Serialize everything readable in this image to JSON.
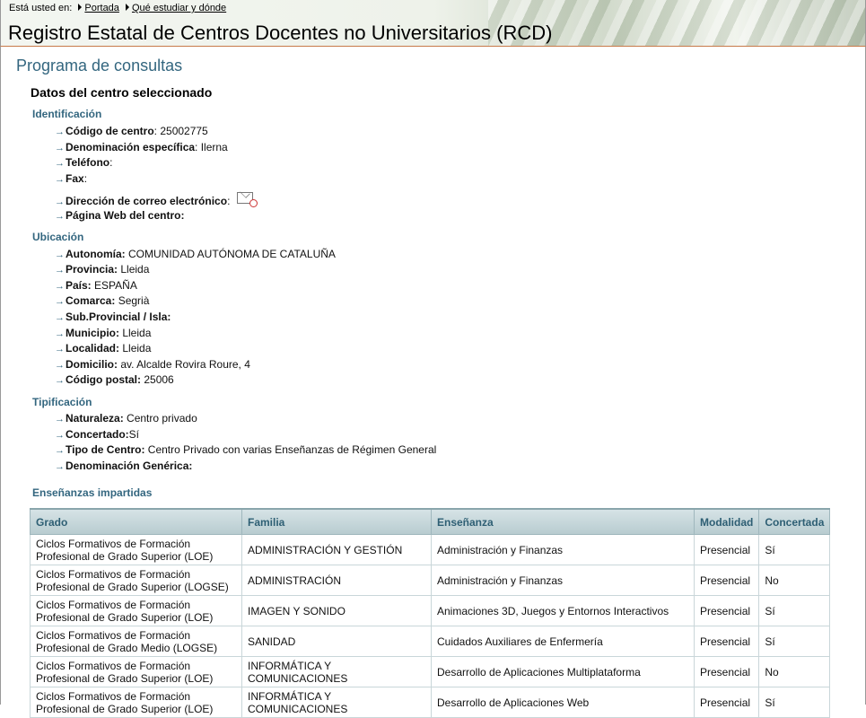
{
  "breadcrumb": {
    "prefix": "Está usted en:",
    "items": [
      "Portada",
      "Qué estudiar y dónde"
    ]
  },
  "site_title": "Registro Estatal de Centros Docentes no Universitarios (RCD)",
  "page_title": "Programa de consultas",
  "section_title": "Datos del centro seleccionado",
  "identificacion": {
    "heading": "Identificación",
    "codigo_label": "Código de centro",
    "codigo_value": ": 25002775",
    "denominacion_label": "Denominación específica",
    "denominacion_value": ": Ilerna",
    "telefono_label": "Teléfono",
    "telefono_value": ":",
    "fax_label": "Fax",
    "fax_value": ":",
    "correo_label": "Dirección de correo electrónico",
    "correo_value": ":",
    "web_label": "Página Web del centro:"
  },
  "ubicacion": {
    "heading": "Ubicación",
    "rows": [
      {
        "label": "Autonomía:",
        "value": "COMUNIDAD AUTÓNOMA DE CATALUÑA"
      },
      {
        "label": "Provincia:",
        "value": "Lleida"
      },
      {
        "label": "País:",
        "value": "ESPAÑA"
      },
      {
        "label": "Comarca:",
        "value": "Segrià"
      },
      {
        "label": "Sub.Provincial / Isla:",
        "value": ""
      },
      {
        "label": "Municipio:",
        "value": "Lleida"
      },
      {
        "label": "Localidad:",
        "value": "Lleida"
      },
      {
        "label": "Domicilio:",
        "value": "av. Alcalde Rovira Roure, 4"
      },
      {
        "label": "Código postal:",
        "value": "25006"
      }
    ]
  },
  "tipificacion": {
    "heading": "Tipificación",
    "rows": [
      {
        "label": "Naturaleza:",
        "value": "Centro privado"
      },
      {
        "label": "Concertado:",
        "value": "Sí"
      },
      {
        "label": "Tipo de Centro:",
        "value": "Centro Privado con varias Enseñanzas de Régimen General"
      },
      {
        "label": "Denominación Genérica:",
        "value": ""
      }
    ]
  },
  "ensenanzas": {
    "heading": "Enseñanzas impartidas",
    "columns": [
      "Grado",
      "Familia",
      "Enseñanza",
      "Modalidad",
      "Concertada"
    ],
    "rows": [
      [
        "Ciclos Formativos de Formación Profesional de Grado Superior (LOE)",
        "ADMINISTRACIÓN Y GESTIÓN",
        "Administración y Finanzas",
        "Presencial",
        "Sí"
      ],
      [
        "Ciclos Formativos de Formación Profesional de Grado Superior (LOGSE)",
        "ADMINISTRACIÓN",
        "Administración y Finanzas",
        "Presencial",
        "No"
      ],
      [
        "Ciclos Formativos de Formación Profesional de Grado Superior (LOE)",
        "IMAGEN Y SONIDO",
        "Animaciones 3D, Juegos y Entornos Interactivos",
        "Presencial",
        "Sí"
      ],
      [
        "Ciclos Formativos de Formación Profesional de Grado Medio (LOGSE)",
        "SANIDAD",
        "Cuidados Auxiliares de Enfermería",
        "Presencial",
        "Sí"
      ],
      [
        "Ciclos Formativos de Formación Profesional de Grado Superior (LOE)",
        "INFORMÁTICA Y COMUNICACIONES",
        "Desarrollo de Aplicaciones Multiplataforma",
        "Presencial",
        "No"
      ],
      [
        "Ciclos Formativos de Formación Profesional de Grado Superior (LOE)",
        "INFORMÁTICA Y COMUNICACIONES",
        "Desarrollo de Aplicaciones Web",
        "Presencial",
        "Sí"
      ]
    ]
  },
  "icons": {
    "mail": "mail-icon"
  }
}
